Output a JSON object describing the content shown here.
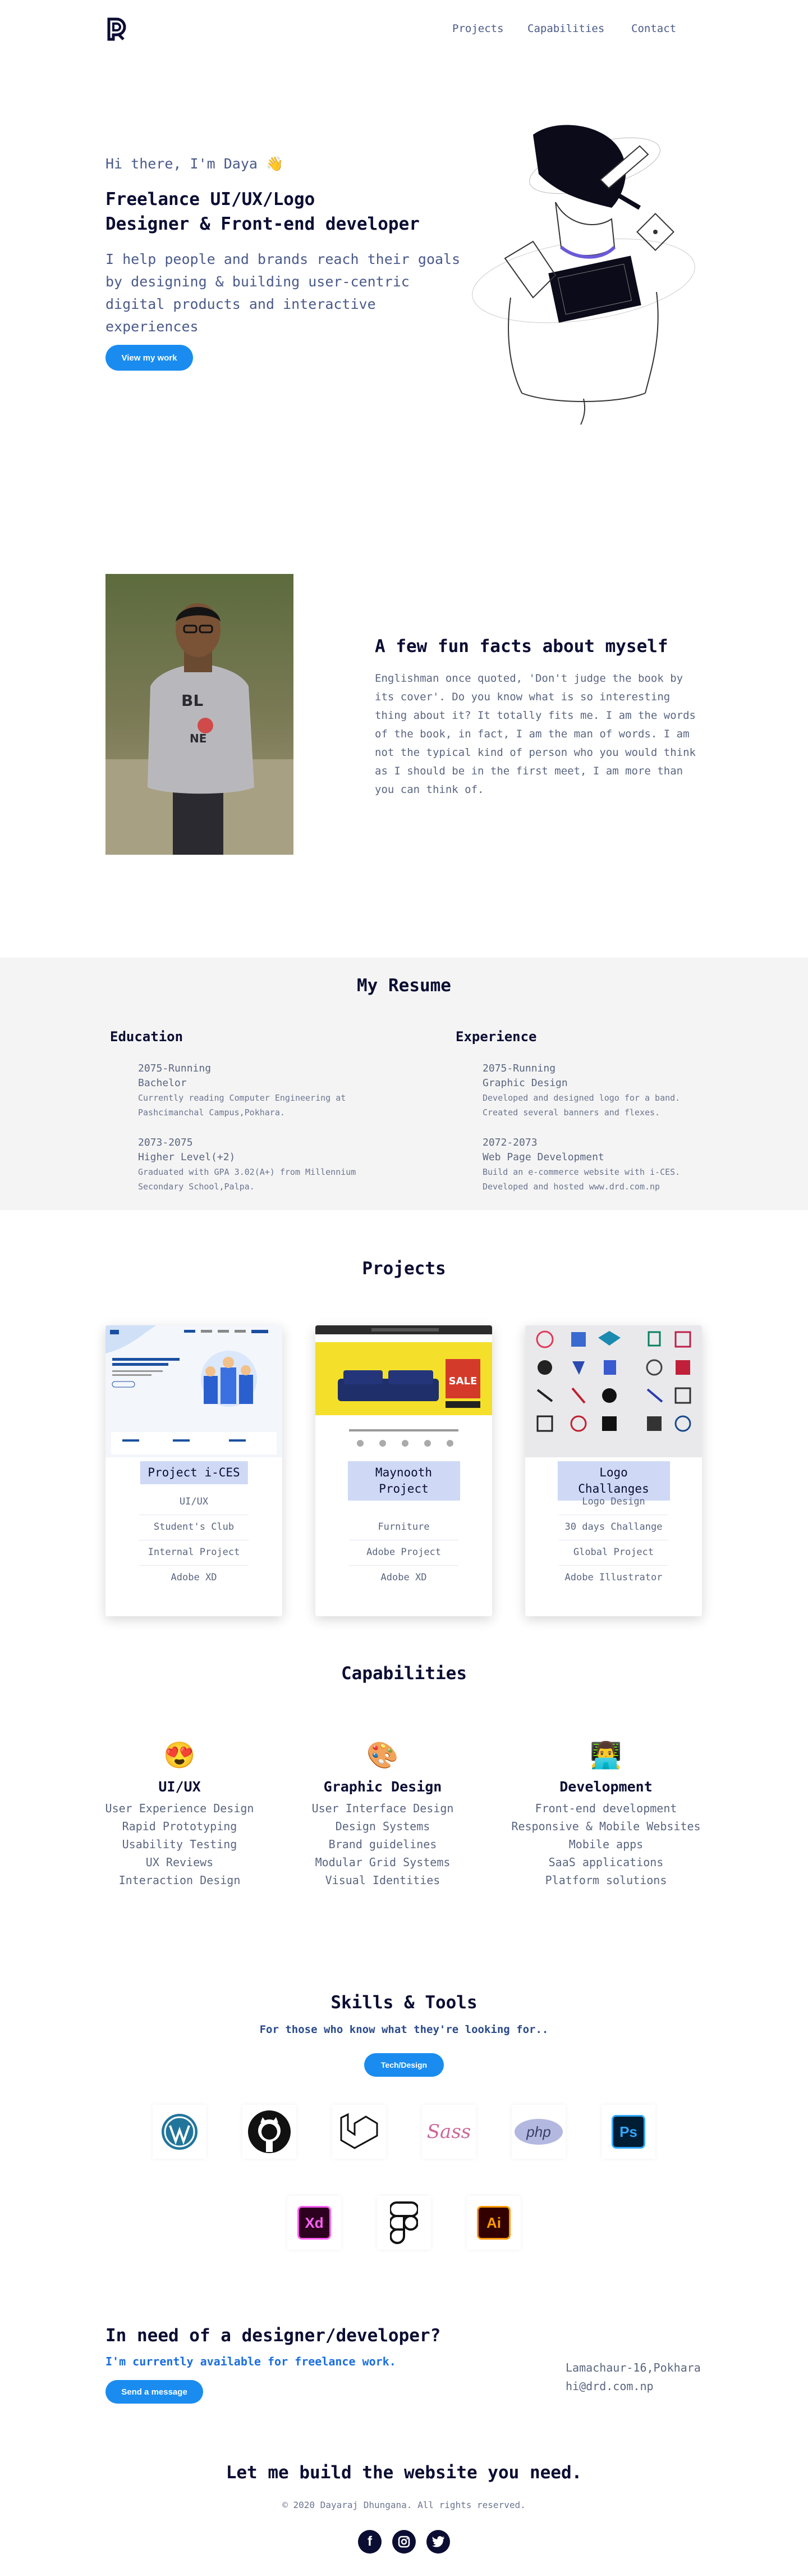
{
  "nav": {
    "links": [
      {
        "label": "Projects"
      },
      {
        "label": "Capabilities"
      },
      {
        "label": "Contact"
      }
    ]
  },
  "hero": {
    "greeting": "Hi there, I'm Daya 👋",
    "title_line1": "Freelance UI/UX/Logo",
    "title_line2": "Designer & Front-end developer",
    "description": "I help people and brands reach their goals by designing & building user-centric digital products and interactive experiences",
    "button_label": "View my work"
  },
  "about": {
    "title": "A few fun facts about myself",
    "text": "Englishman once quoted, 'Don't judge the book by its cover'. Do you know what is so interesting thing about it? It totally fits me. I am the words of the book, in fact, I am the man of words. I am not the typical kind of person who you would think as I should be in the first meet, I am more than you can think of.",
    "photo_shirt_text_1": "BL",
    "photo_shirt_text_2": "NE"
  },
  "resume": {
    "title": "My Resume",
    "education": {
      "heading": "Education",
      "items": [
        {
          "period": "2075-Running",
          "role": "Bachelor",
          "desc": "Currently reading Computer Engineering at Pashcimanchal Campus,Pokhara."
        },
        {
          "period": "2073-2075",
          "role": "Higher Level(+2)",
          "desc": "Graduated with GPA 3.02(A+) from Millennium Secondary School,Palpa."
        }
      ]
    },
    "experience": {
      "heading": "Experience",
      "items": [
        {
          "period": "2075-Running",
          "role": "Graphic Design",
          "desc": "Developed and designed logo for a band. Created several banners and flexes."
        },
        {
          "period": "2072-2073",
          "role": "Web Page Development",
          "desc": "Build an e-commerce website with i-CES. Developed and hosted www.drd.com.np"
        }
      ]
    }
  },
  "projects": {
    "title": "Projects",
    "cards": [
      {
        "name": "Project i-CES",
        "tags": [
          "UI/UX",
          "Student's Club",
          "Internal Project",
          "Adobe XD"
        ]
      },
      {
        "name": "Maynooth Project",
        "tags": [
          "Furniture",
          "Adobe Project",
          "Adobe XD"
        ]
      },
      {
        "name": "Logo Challanges",
        "tags": [
          "Logo Design",
          "30 days Challange",
          "Global Project",
          "Adobe Illustrator"
        ]
      }
    ],
    "thumb_sale": "SALE"
  },
  "capabilities": {
    "title": "Capabilities",
    "columns": [
      {
        "emoji": "😍",
        "name": "UI/UX",
        "items": [
          "User Experience Design",
          "Rapid Prototyping",
          "Usability Testing",
          "UX Reviews",
          "Interaction Design"
        ]
      },
      {
        "emoji": "🎨",
        "name": "Graphic Design",
        "items": [
          "User Interface Design",
          "Design Systems",
          "Brand guidelines",
          "Modular Grid Systems",
          "Visual Identities"
        ]
      },
      {
        "emoji": "👨‍💻",
        "name": "Development",
        "items": [
          "Front-end development",
          "Responsive & Mobile Websites",
          "Mobile apps",
          "SaaS applications",
          "Platform solutions"
        ]
      }
    ]
  },
  "skills": {
    "title": "Skills & Tools",
    "subtitle": "For those who know what they're looking for..",
    "button_label": "Tech/Design",
    "tools": [
      {
        "icon": "wordpress-icon"
      },
      {
        "icon": "github-icon"
      },
      {
        "icon": "laravel-icon"
      },
      {
        "icon": "sass-icon",
        "label": "Sass"
      },
      {
        "icon": "php-icon",
        "label": "php"
      },
      {
        "icon": "photoshop-icon",
        "label": "Ps"
      },
      {
        "icon": "adobe-xd-icon",
        "label": "Xd"
      },
      {
        "icon": "figma-icon"
      },
      {
        "icon": "illustrator-icon",
        "label": "Ai"
      }
    ]
  },
  "contact": {
    "title": "In need of a designer/developer?",
    "subtitle": "I'm currently available for freelance work.",
    "button_label": "Send a message",
    "address": "Lamachaur-16,Pokhara",
    "email": "hi@drd.com.np"
  },
  "footer": {
    "title": "Let me build the website you need.",
    "copyright": "© 2020 Dayaraj Dhungana. All rights reserved.",
    "socials": [
      {
        "icon": "facebook-icon",
        "glyph": "f"
      },
      {
        "icon": "instagram-icon"
      },
      {
        "icon": "twitter-icon"
      }
    ]
  },
  "colors": {
    "accent": "#1a8cf0",
    "heading": "#0b0d33",
    "body_text": "#5a6580",
    "resume_bg": "#f4f4f4",
    "project_label_bg": "#cfd9f6"
  }
}
